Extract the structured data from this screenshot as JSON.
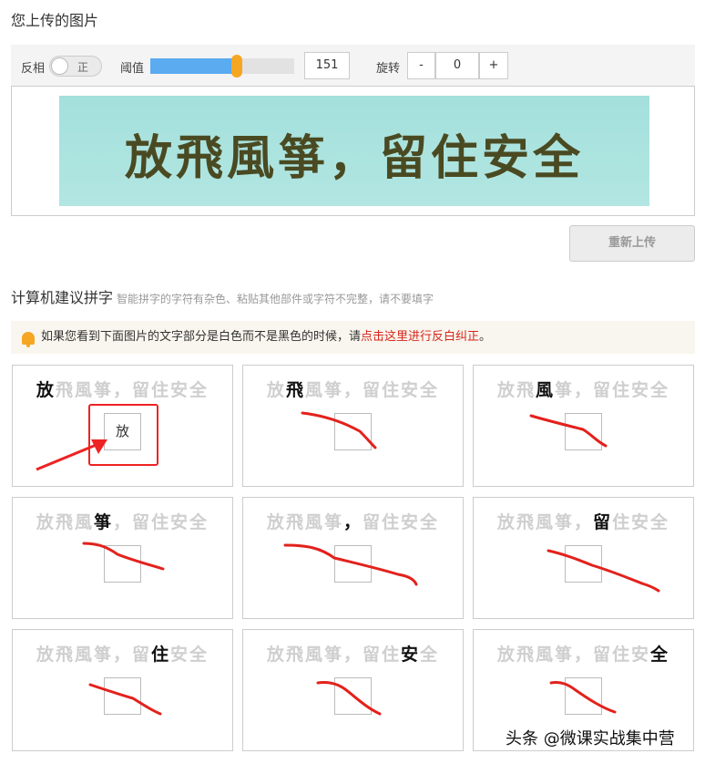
{
  "header": {
    "title": "您上传的图片"
  },
  "toolbar": {
    "invert_label": "反相",
    "invert_toggle_text": "正",
    "threshold_label": "阈值",
    "threshold_value": "151",
    "threshold_fraction": 0.6,
    "rotate_label": "旋转",
    "rotate_minus": "-",
    "rotate_value": "0",
    "rotate_plus": "+",
    "accent_color": "#5aabf0",
    "thumb_color": "#f5a623"
  },
  "preview": {
    "image_text": "放飛風箏，留住安全"
  },
  "reupload": {
    "label": "重新上传"
  },
  "suggest": {
    "title": "计算机建议拼字",
    "hint": "智能拼字的字符有杂色、粘贴其他部件或字符不完整，请不要填字"
  },
  "notice": {
    "icon": "bell-icon",
    "text_before": "如果您看到下面图片的文字部分是白色而不是黑色的时候，请",
    "link": "点击这里进行反白纠正",
    "text_after": "。"
  },
  "strip_chars": [
    "放",
    "飛",
    "風",
    "箏",
    "，",
    "留",
    "住",
    "安",
    "全"
  ],
  "cards": [
    {
      "highlight_index": 0,
      "input_value": "放"
    },
    {
      "highlight_index": 1,
      "input_value": ""
    },
    {
      "highlight_index": 2,
      "input_value": ""
    },
    {
      "highlight_index": 3,
      "input_value": ""
    },
    {
      "highlight_index": 4,
      "input_value": ""
    },
    {
      "highlight_index": 5,
      "input_value": ""
    },
    {
      "highlight_index": 6,
      "input_value": ""
    },
    {
      "highlight_index": 7,
      "input_value": ""
    },
    {
      "highlight_index": 8,
      "input_value": ""
    }
  ],
  "watermark": {
    "text": "头条 @微课实战集中营"
  }
}
